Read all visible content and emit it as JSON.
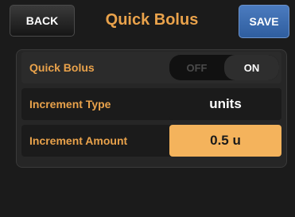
{
  "header": {
    "back_label": "BACK",
    "title": "Quick Bolus",
    "save_label": "SAVE"
  },
  "settings": {
    "quick_bolus": {
      "label": "Quick Bolus",
      "off_label": "OFF",
      "on_label": "ON",
      "selected": "ON"
    },
    "increment_type": {
      "label": "Increment Type",
      "value": "units"
    },
    "increment_amount": {
      "label": "Increment Amount",
      "value": "0.5 u"
    }
  },
  "colors": {
    "accent_orange": "#e9a24b",
    "highlight_orange": "#f4b35c",
    "save_blue": "#3a6fb2"
  }
}
